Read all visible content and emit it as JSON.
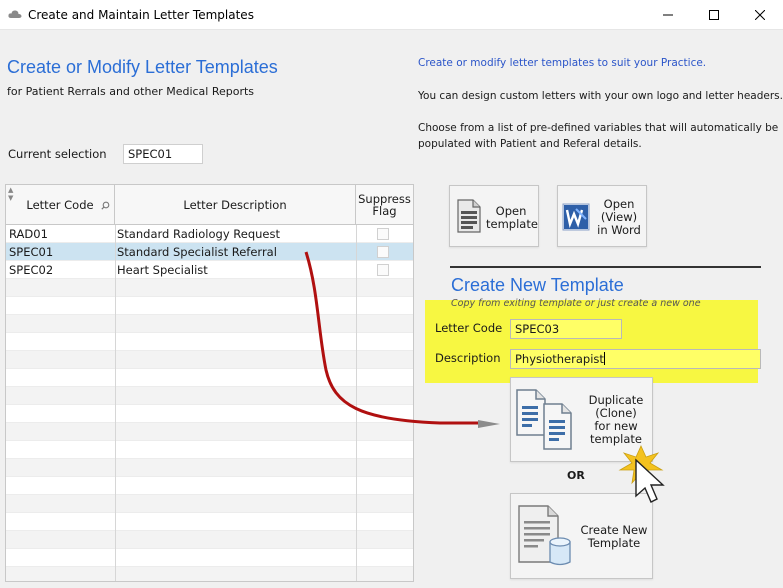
{
  "window": {
    "title": "Create and Maintain Letter Templates",
    "controls": [
      "minimize-icon",
      "maximize-icon",
      "close-icon"
    ]
  },
  "header": {
    "title": "Create or Modify Letter Templates",
    "subtitle": "for Patient Rerrals and other Medical Reports"
  },
  "info": {
    "line1": "Create or modify letter templates to suit your Practice.",
    "line2": "You can design custom letters with your own logo and letter headers.",
    "line3a": "Choose from a list of pre-defined variables that will automatically be",
    "line3b": "populated with Patient and Referal details."
  },
  "selection": {
    "label": "Current selection",
    "value": "SPEC01"
  },
  "grid": {
    "columns": {
      "code": "Letter Code",
      "description": "Letter Description",
      "flag_line1": "Suppress",
      "flag_line2": "Flag"
    },
    "rows": [
      {
        "code": "RAD01",
        "description": "Standard Radiology Request",
        "suppress": false
      },
      {
        "code": "SPEC01",
        "description": "Standard Specialist Referral",
        "suppress": false
      },
      {
        "code": "SPEC02",
        "description": "Heart Specialist",
        "suppress": false
      }
    ],
    "selected_row": 1
  },
  "buttons": {
    "open_template": {
      "line1": "Open",
      "line2": "template"
    },
    "open_word": {
      "line1": "Open",
      "line2": "(View)",
      "line3": "in Word"
    },
    "duplicate": {
      "line1": "Duplicate",
      "line2": "(Clone)",
      "line3": "for new",
      "line4": "template"
    },
    "or_label": "OR",
    "create_new": {
      "line1": "Create New",
      "line2": "Template"
    }
  },
  "new_template": {
    "title": "Create New Template",
    "hint": "Copy from exiting template or just create a new one",
    "letter_code_label": "Letter Code",
    "letter_code_value": "SPEC03",
    "description_label": "Description",
    "description_value": "Physiotherapist"
  },
  "colors": {
    "accent_blue": "#2b6ed6",
    "highlight_yellow": "#f7f742",
    "selected_row": "#cce3f1",
    "arrow_red": "#b01010"
  }
}
